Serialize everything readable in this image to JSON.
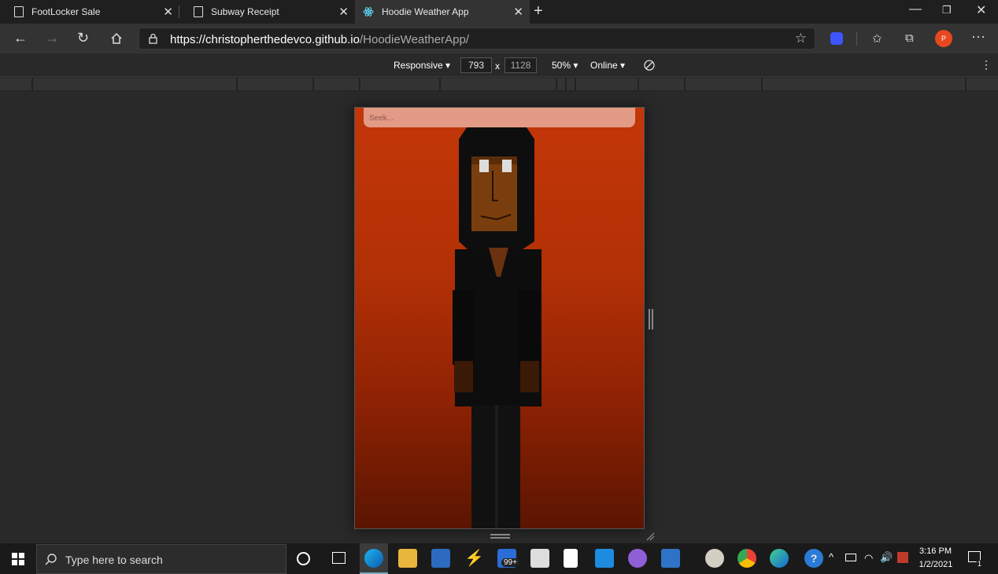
{
  "browser": {
    "tabs": [
      {
        "title": "FootLocker Sale",
        "icon": "page-icon"
      },
      {
        "title": "Subway Receipt",
        "icon": "page-icon"
      },
      {
        "title": "Hoodie Weather App",
        "icon": "react-icon",
        "active": true
      }
    ],
    "url_host": "https://christopherthedevco.github.io",
    "url_path": "/HoodieWeatherApp/",
    "profile_initial": "P"
  },
  "devtools": {
    "device": "Responsive",
    "width": "793",
    "times": "x",
    "height": "1128",
    "zoom": "50%",
    "throttle": "Online"
  },
  "app": {
    "search_placeholder": "Seek...",
    "background_color": "#c33708"
  },
  "taskbar": {
    "search_placeholder": "Type here to search",
    "time": "3:16 PM",
    "date": "1/2/2021",
    "mail_badge": "99+",
    "notification_count": "1"
  }
}
